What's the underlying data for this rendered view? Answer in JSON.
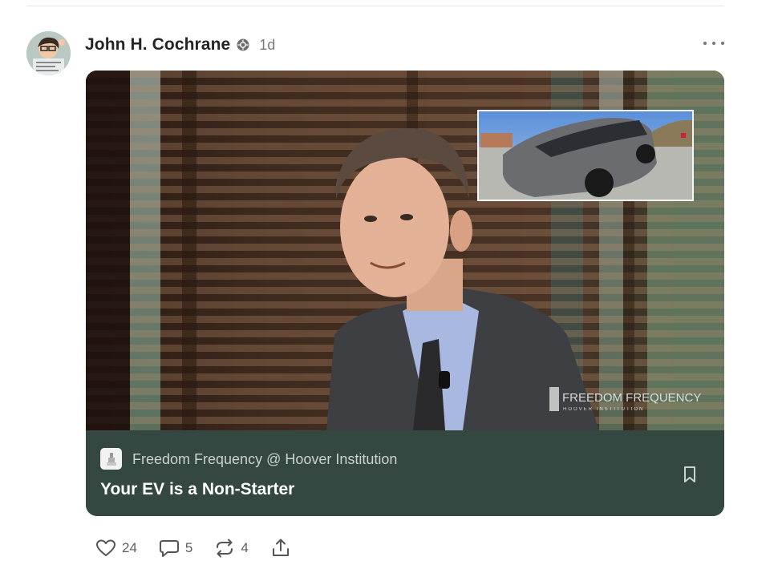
{
  "post": {
    "author": "John H. Cochrane",
    "timestamp": "1d",
    "badge_icon": "verified-badge-icon",
    "more_icon": "ellipsis-icon"
  },
  "media": {
    "watermark_title": "FREEDOM FREQUENCY",
    "watermark_subtitle": "HOOVER INSTITUTION",
    "inset_description_icon": "car-thumbnail"
  },
  "card": {
    "publication": "Freedom Frequency @ Hoover Institution",
    "title": "Your EV is a Non-Starter",
    "bookmark_icon": "bookmark-icon",
    "background_color": "#344740"
  },
  "actions": {
    "likes": "24",
    "comments": "5",
    "restacks": "4",
    "like_icon": "heart-icon",
    "comment_icon": "comment-icon",
    "restack_icon": "restack-icon",
    "share_icon": "share-icon"
  }
}
